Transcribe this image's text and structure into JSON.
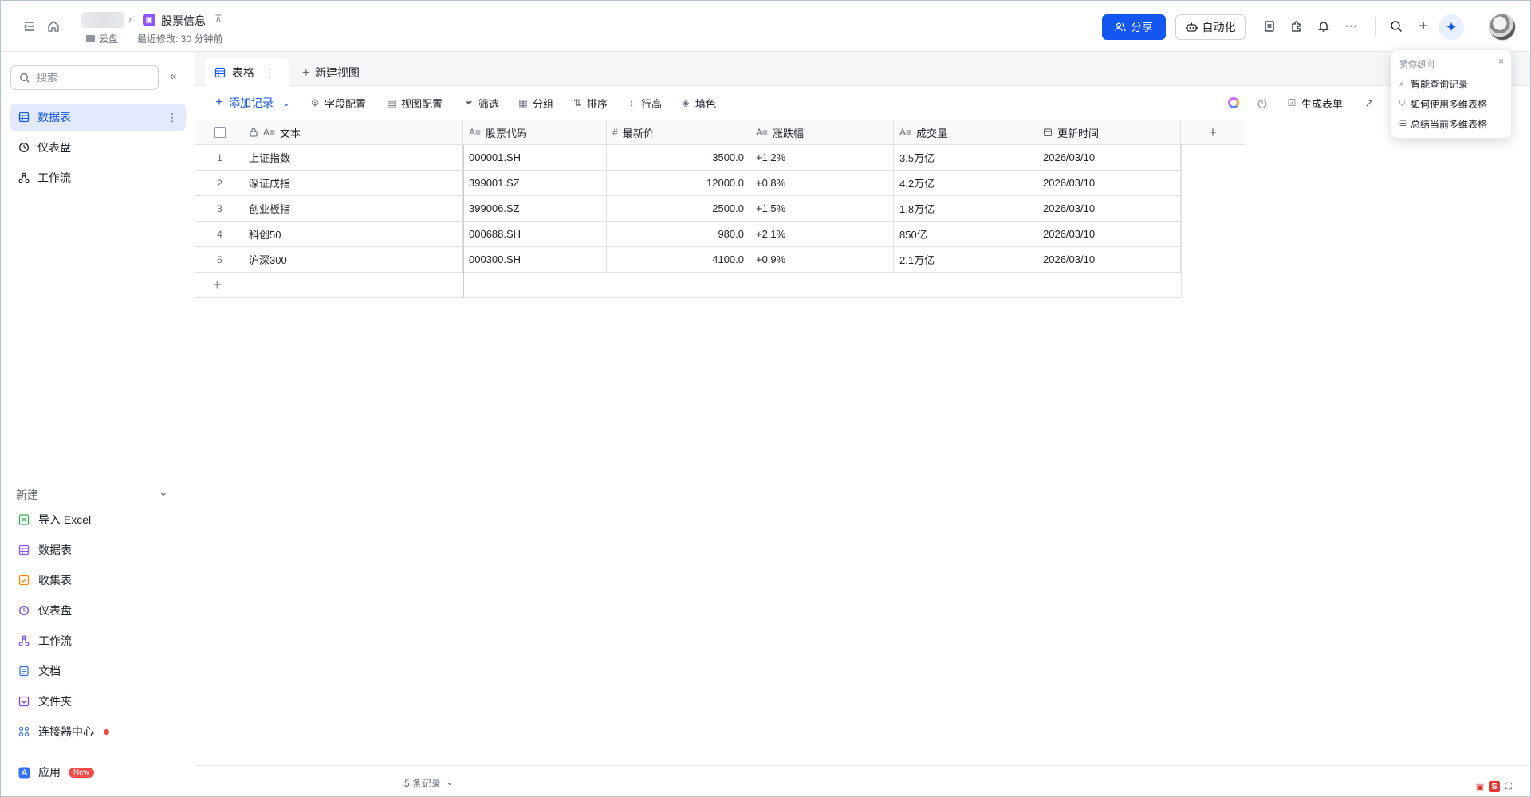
{
  "header": {
    "doc_title": "股票信息",
    "location": "云盘",
    "last_modified": "最近修改: 30 分钟前",
    "share_label": "分享",
    "automation_label": "自动化"
  },
  "sidebar": {
    "search_placeholder": "搜索",
    "items": [
      {
        "label": "数据表",
        "active": true
      },
      {
        "label": "仪表盘",
        "active": false
      },
      {
        "label": "工作流",
        "active": false
      }
    ],
    "new_section_title": "新建",
    "new_items": [
      {
        "label": "导入 Excel",
        "icon": "excel-icon",
        "color": "#34a853"
      },
      {
        "label": "数据表",
        "icon": "table-icon",
        "color": "#8c54ff"
      },
      {
        "label": "收集表",
        "icon": "form-icon",
        "color": "#ff8800"
      },
      {
        "label": "仪表盘",
        "icon": "dashboard-icon",
        "color": "#7f3bf5"
      },
      {
        "label": "工作流",
        "icon": "workflow-icon",
        "color": "#7f3bf5"
      },
      {
        "label": "文档",
        "icon": "doc-icon",
        "color": "#3370ff"
      },
      {
        "label": "文件夹",
        "icon": "folder-icon",
        "color": "#7f3bf5"
      },
      {
        "label": "连接器中心",
        "icon": "connector-icon",
        "color": "#3370ff"
      }
    ],
    "app_label": "应用",
    "app_badge": "New"
  },
  "tabs": {
    "active_tab": "表格",
    "new_view": "新建视图"
  },
  "toolbar": {
    "add_record": "添加记录",
    "field_config": "字段配置",
    "view_config": "视图配置",
    "filter": "筛选",
    "group": "分组",
    "sort": "排序",
    "row_height": "行高",
    "fill_color": "填色",
    "generate_form": "生成表单"
  },
  "table": {
    "columns": [
      {
        "label": "文本",
        "icon": "text-field-icon"
      },
      {
        "label": "股票代码",
        "icon": "text-field-icon"
      },
      {
        "label": "最新价",
        "icon": "number-field-icon"
      },
      {
        "label": "涨跌幅",
        "icon": "text-field-icon"
      },
      {
        "label": "成交量",
        "icon": "text-field-icon"
      },
      {
        "label": "更新时间",
        "icon": "date-field-icon"
      }
    ],
    "rows": [
      {
        "idx": "1",
        "cells": [
          "上证指数",
          "000001.SH",
          "3500.0",
          "+1.2%",
          "3.5万亿",
          "2026/03/10"
        ]
      },
      {
        "idx": "2",
        "cells": [
          "深证成指",
          "399001.SZ",
          "12000.0",
          "+0.8%",
          "4.2万亿",
          "2026/03/10"
        ]
      },
      {
        "idx": "3",
        "cells": [
          "创业板指",
          "399006.SZ",
          "2500.0",
          "+1.5%",
          "1.8万亿",
          "2026/03/10"
        ]
      },
      {
        "idx": "4",
        "cells": [
          "科创50",
          "000688.SH",
          "980.0",
          "+2.1%",
          "850亿",
          "2026/03/10"
        ]
      },
      {
        "idx": "5",
        "cells": [
          "沪深300",
          "000300.SH",
          "4100.0",
          "+0.9%",
          "2.1万亿",
          "2026/03/10"
        ]
      }
    ]
  },
  "footer": {
    "record_count": "5 条记录"
  },
  "popover": {
    "title": "猜你想问",
    "items": [
      "智能查询记录",
      "如何使用多维表格",
      "总结当前多维表格"
    ]
  },
  "colors": {
    "accent": "#1456f0",
    "active_bg": "#e1eaff"
  }
}
